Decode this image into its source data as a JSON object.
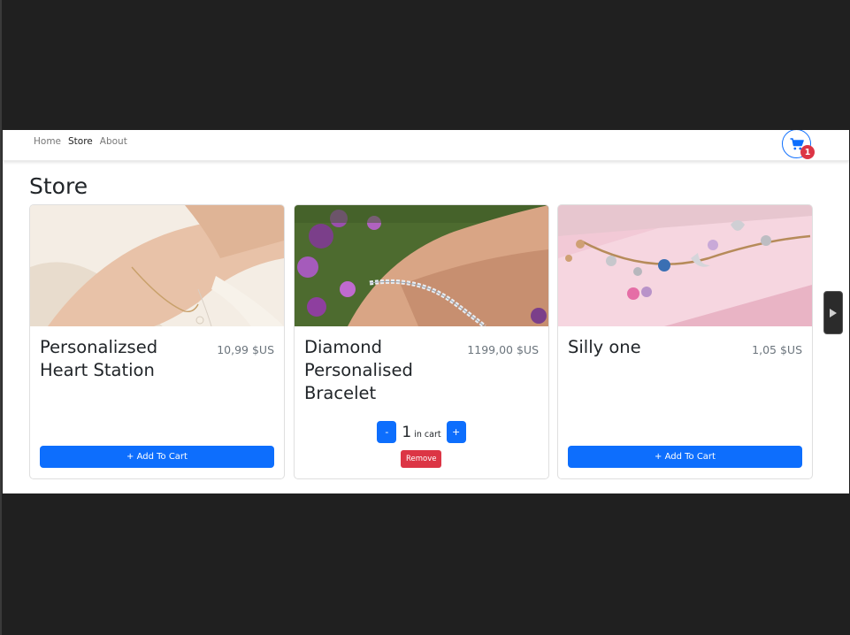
{
  "nav": {
    "links": [
      {
        "label": "Home",
        "active": false
      },
      {
        "label": "Store",
        "active": true
      },
      {
        "label": "About",
        "active": false
      }
    ],
    "cart_icon": "shopping-cart-icon",
    "cart_count": "1"
  },
  "page": {
    "title": "Store"
  },
  "products": [
    {
      "name": "Personalizsed Heart Station",
      "price": "10,99 $US",
      "image": "bracelet-on-wrist-photo",
      "add_label": "+ Add To Cart"
    },
    {
      "name": "Diamond Personalised Bracelet",
      "price": "1199,00 $US",
      "image": "diamond-bracelet-photo",
      "in_cart": {
        "minus_label": "-",
        "quantity": "1",
        "suffix": "in cart",
        "plus_label": "+",
        "remove_label": "Remove"
      }
    },
    {
      "name": "Silly one",
      "price": "1,05 $US",
      "image": "charm-bracelet-photo",
      "add_label": "+ Add To Cart"
    }
  ],
  "colors": {
    "primary": "#0d6efd",
    "danger": "#dc3545",
    "text": "#212529",
    "muted": "#6c757d",
    "outer_background": "#202020"
  },
  "side_control": "next-arrow-icon"
}
